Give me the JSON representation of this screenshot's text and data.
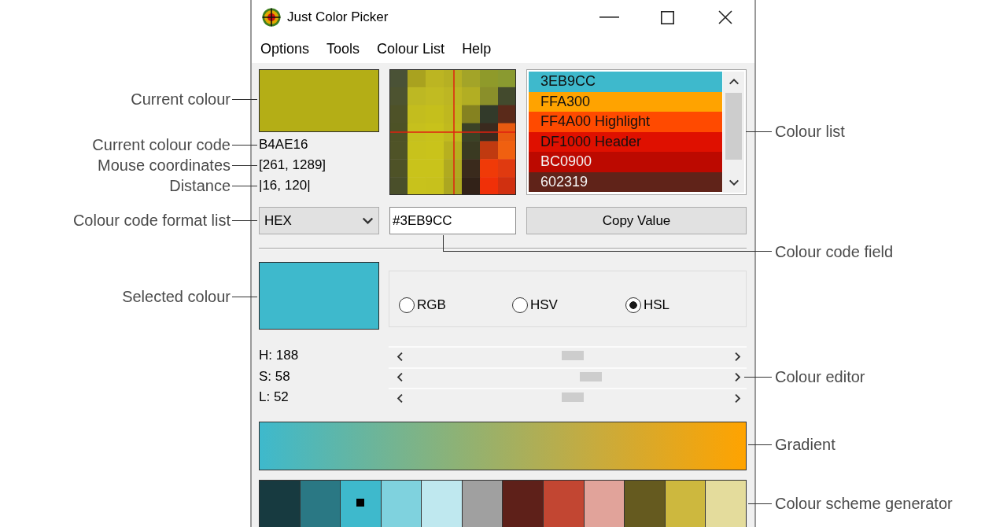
{
  "window": {
    "title": "Just Color Picker"
  },
  "menu": [
    "Options",
    "Tools",
    "Colour List",
    "Help"
  ],
  "current_colour": {
    "color": "#b4ae16",
    "code": "B4AE16",
    "mouse_coordinates": "[261, 1289]",
    "distance": "|16, 120|"
  },
  "colour_list": [
    {
      "label": "3EB9CC",
      "color": "#3eb9cc"
    },
    {
      "label": "FFA300",
      "color": "#ffa300"
    },
    {
      "label": "FF4A00 Highlight",
      "color": "#ff4a00"
    },
    {
      "label": "DF1000 Header",
      "color": "#df1000"
    },
    {
      "label": "BC0900",
      "color": "#bc0900"
    },
    {
      "label": "602319",
      "color": "#602319"
    }
  ],
  "format_list": {
    "value": "HEX"
  },
  "code_field": {
    "value": "#3EB9CC"
  },
  "copy_button": "Copy Value",
  "selected_colour": {
    "color": "#3eb9cc"
  },
  "modes": [
    {
      "label": "RGB",
      "selected": false
    },
    {
      "label": "HSV",
      "selected": false
    },
    {
      "label": "HSL",
      "selected": true
    }
  ],
  "editor": [
    {
      "label": "H: 188",
      "level": 0.52
    },
    {
      "label": "S: 58",
      "level": 0.58
    },
    {
      "label": "L: 52",
      "level": 0.52
    }
  ],
  "scheme": [
    {
      "color": "#173a40",
      "selected": false
    },
    {
      "color": "#2a7884",
      "selected": false
    },
    {
      "color": "#3eb9cc",
      "selected": true
    },
    {
      "color": "#7fd2de",
      "selected": false
    },
    {
      "color": "#bfe8ef",
      "selected": false
    },
    {
      "color": "#a0a0a0",
      "selected": false
    },
    {
      "color": "#5e2019",
      "selected": false
    },
    {
      "color": "#c24632",
      "selected": false
    },
    {
      "color": "#e1a39a",
      "selected": false
    },
    {
      "color": "#655a1f",
      "selected": false
    },
    {
      "color": "#cdb83e",
      "selected": false
    },
    {
      "color": "#e4dc9c",
      "selected": false
    }
  ],
  "callouts": {
    "left": [
      "Current colour",
      "Current colour code",
      "Mouse coordinates",
      "Distance",
      "Colour code format list",
      "Selected colour"
    ],
    "right": [
      "Colour list",
      "Colour code field",
      "Colour editor",
      "Gradient",
      "Colour scheme generator"
    ]
  }
}
